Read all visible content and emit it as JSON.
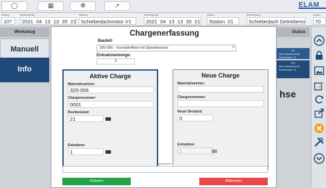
{
  "header": {
    "logo": "ELAM",
    "fields": [
      {
        "label": "Auftrag",
        "value": "107"
      },
      {
        "label": "Startzeitpunkt",
        "value": "2021_04_13_13_35_21"
      },
      {
        "label": "Variante",
        "value": "Schiebedachmotor V1"
      },
      {
        "label": "Startzeitpunkt",
        "value": "2021_04_13_13_35_21"
      },
      {
        "label": "Station",
        "value": "Station_01"
      },
      {
        "label": "Bezeichnung",
        "value": "Schiebedach Getriebemotor V1"
      },
      {
        "label": "Anzahl",
        "value": "70"
      }
    ]
  },
  "sidebar": {
    "header": "Werkzeug",
    "items": [
      {
        "label": "Manuell"
      },
      {
        "label": "Info"
      }
    ]
  },
  "status": {
    "header": "Status",
    "rows": [
      {
        "lines": [
          "3/3",
          "bach-Getriebemotor",
          "Schiebedach V1"
        ]
      },
      {
        "lines": [
          "6/13",
          "bach-Getriebemotor",
          "Schiebedach V1"
        ]
      }
    ],
    "background_text": "hse"
  },
  "modal": {
    "title": "Chargenerfassung",
    "bauteil_label": "Bauteil:",
    "bauteil_value": "320-056 - Kunststoffrad mit Spindelachse",
    "menge_label": "Entnahmemenge:",
    "menge_value": "1",
    "active": {
      "title": "Aktive Charge",
      "material_label": "Materialnummer:",
      "material_value": "320-056",
      "charge_label": "Chargennummer:",
      "charge_value": "0001",
      "rest_label": "Restbestand:",
      "rest_value": "21",
      "entnahme_label": "Entnahme:",
      "entnahme_value": "1"
    },
    "new": {
      "title": "Neue Charge",
      "material_label": "Materialnummer:",
      "material_value": "",
      "charge_label": "Chargennummer:",
      "charge_value": "",
      "bestand_label": "Neuer Bestand:",
      "bestand_value": "0",
      "entnahme_label": "Entnahme:",
      "entnahme_value": "1"
    },
    "sysinfo_label": "Systeminfo",
    "sysinfo_value": "",
    "confirm_label": "Erfassen",
    "cancel_label": "Abbrechen"
  },
  "colors": {
    "confirm": "#22a34a",
    "cancel": "#e8484a",
    "accent": "#1f4a7a"
  },
  "icons": [
    "home-icon",
    "calendar-icon",
    "settings-icon",
    "pointer-icon",
    "arrow-up-circle-icon",
    "lock-icon",
    "image-icon",
    "edit-icon",
    "refresh-icon",
    "export-icon",
    "close-circle-icon",
    "tools-icon",
    "arrow-down-circle-icon"
  ]
}
